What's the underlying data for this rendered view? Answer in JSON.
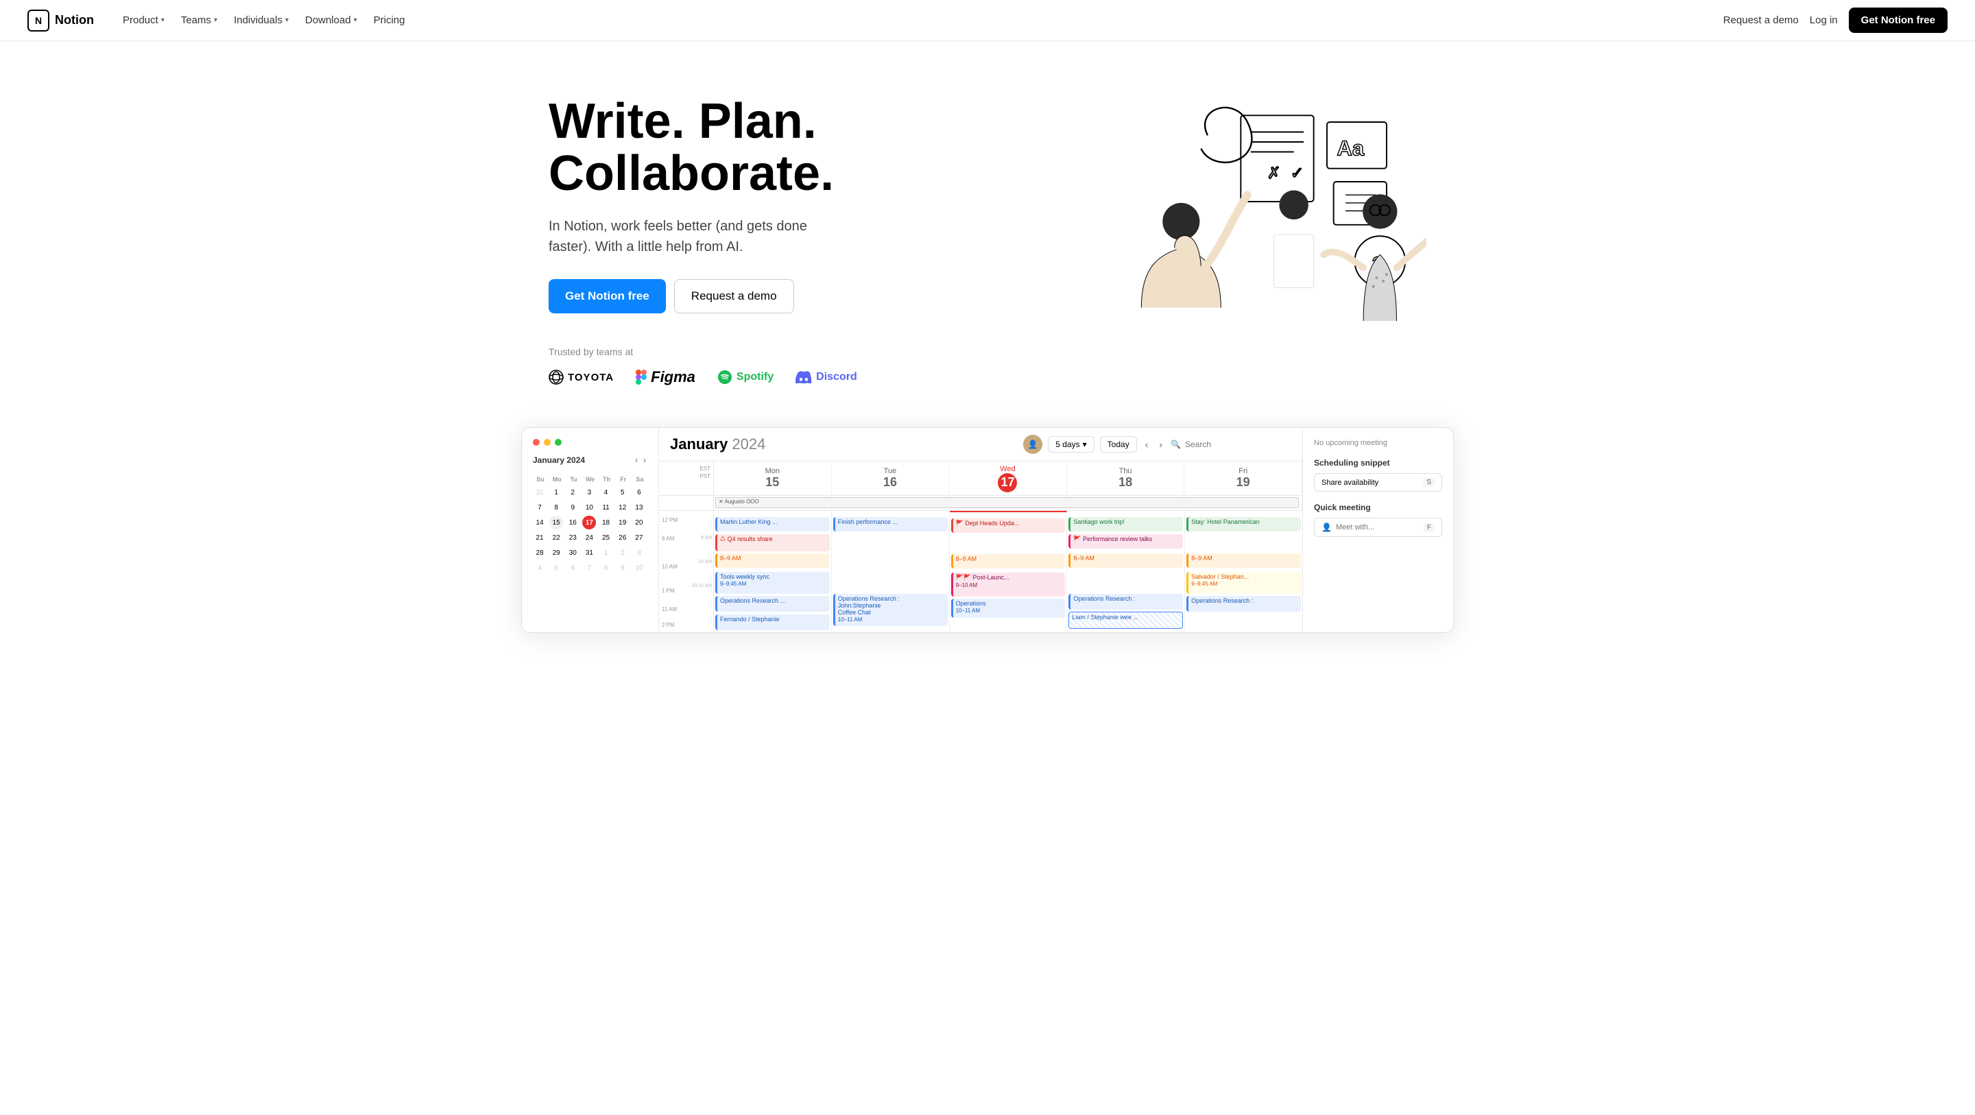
{
  "nav": {
    "logo": "Notion",
    "logo_icon": "N",
    "links": [
      {
        "label": "Product",
        "has_dropdown": true
      },
      {
        "label": "Teams",
        "has_dropdown": true
      },
      {
        "label": "Individuals",
        "has_dropdown": true
      },
      {
        "label": "Download",
        "has_dropdown": true
      },
      {
        "label": "Pricing",
        "has_dropdown": false
      }
    ],
    "request_demo": "Request a demo",
    "login": "Log in",
    "cta": "Get Notion free"
  },
  "hero": {
    "title": "Write. Plan.\nCollaborate.",
    "subtitle": "In Notion, work feels better (and gets done faster). With a little help from AI.",
    "cta_primary": "Get Notion free",
    "cta_secondary": "Request a demo",
    "trusted_label": "Trusted by teams at",
    "brands": [
      "TOYOTA",
      "Figma",
      "Spotify",
      "Discord"
    ]
  },
  "calendar": {
    "window_controls": [
      "●",
      "●",
      "●"
    ],
    "mini_cal": {
      "title": "January 2024",
      "day_labels": [
        "Su",
        "Mo",
        "Tu",
        "We",
        "Th",
        "Fr",
        "Sa"
      ],
      "rows": [
        [
          {
            "n": "31",
            "other": true
          },
          {
            "n": "1"
          },
          {
            "n": "2"
          },
          {
            "n": "3"
          },
          {
            "n": "4"
          },
          {
            "n": "5"
          },
          {
            "n": "6"
          }
        ],
        [
          {
            "n": "7"
          },
          {
            "n": "8"
          },
          {
            "n": "9"
          },
          {
            "n": "10"
          },
          {
            "n": "11"
          },
          {
            "n": "12"
          },
          {
            "n": "13"
          }
        ],
        [
          {
            "n": "14"
          },
          {
            "n": "15",
            "sel": true
          },
          {
            "n": "16"
          },
          {
            "n": "17",
            "today": true
          },
          {
            "n": "18"
          },
          {
            "n": "19"
          },
          {
            "n": "20"
          }
        ],
        [
          {
            "n": "21"
          },
          {
            "n": "22"
          },
          {
            "n": "23"
          },
          {
            "n": "24"
          },
          {
            "n": "25"
          },
          {
            "n": "26"
          },
          {
            "n": "27"
          }
        ],
        [
          {
            "n": "28"
          },
          {
            "n": "29"
          },
          {
            "n": "30"
          },
          {
            "n": "31"
          },
          {
            "n": "1",
            "other": true
          },
          {
            "n": "2",
            "other": true
          },
          {
            "n": "3",
            "other": true
          }
        ],
        [
          {
            "n": "4",
            "other": true
          },
          {
            "n": "5",
            "other": true
          },
          {
            "n": "6",
            "other": true
          },
          {
            "n": "7",
            "other": true
          },
          {
            "n": "8",
            "other": true
          },
          {
            "n": "9",
            "other": true
          },
          {
            "n": "10",
            "other": true
          }
        ]
      ]
    },
    "toolbar": {
      "days_btn": "5 days",
      "today_btn": "Today",
      "search_placeholder": "Search"
    },
    "header_title": "January",
    "header_year": "2024",
    "days": [
      {
        "label": "Mon 15",
        "date": "15",
        "today": false
      },
      {
        "label": "Tue 16",
        "date": "16",
        "today": false
      },
      {
        "label": "Wed 17",
        "date": "17",
        "today": true
      },
      {
        "label": "Thu 18",
        "date": "18",
        "today": false
      },
      {
        "label": "Fri 19",
        "date": "19",
        "today": false
      }
    ],
    "timezones": [
      "EST",
      "PST"
    ],
    "allday_events": [
      {
        "col": 0,
        "text": "Augusto OOO",
        "color": "gray",
        "span": 5
      }
    ],
    "events": {
      "col0": [
        {
          "text": "Martin Luther King ...",
          "top": "10%",
          "height": "12%",
          "color": "blue"
        },
        {
          "text": "Q4 results share",
          "top": "22%",
          "height": "12%",
          "color": "red"
        },
        {
          "text": "8–9 AM",
          "top": "34%",
          "height": "12%",
          "color": "orange"
        },
        {
          "text": "Tools weekly sync\n9–9:45 AM",
          "top": "50%",
          "height": "16%",
          "color": "blue"
        },
        {
          "text": "Operations Research ...",
          "top": "68%",
          "height": "14%",
          "color": "blue"
        },
        {
          "text": "Fernando / Stephanie",
          "top": "84%",
          "height": "14%",
          "color": "blue"
        }
      ],
      "col1": [
        {
          "text": "Finish performance ...",
          "top": "10%",
          "height": "12%",
          "color": "blue"
        },
        {
          "text": "Operations Research :\nJohn:Stephanie\nCoffee Chat\n10–11 AM",
          "top": "68%",
          "height": "22%",
          "color": "blue"
        }
      ],
      "col2": [
        {
          "text": "Dept Heads Upda...",
          "top": "10%",
          "height": "12%",
          "color": "red"
        },
        {
          "text": "8–9 AM",
          "top": "34%",
          "height": "12%",
          "color": "orange"
        },
        {
          "text": "Post-Launc...\n9–10 AM",
          "top": "50%",
          "height": "18%",
          "color": "pink"
        },
        {
          "text": "Operations\n10–11 AM",
          "top": "70%",
          "height": "16%",
          "color": "blue"
        }
      ],
      "col3": [
        {
          "text": "Santiago work trip!",
          "top": "10%",
          "height": "12%",
          "color": "green"
        },
        {
          "text": "Performance review talks",
          "top": "22%",
          "height": "12%",
          "color": "pink"
        },
        {
          "text": "8–9 AM",
          "top": "34%",
          "height": "12%",
          "color": "orange"
        },
        {
          "text": "Operations Research :",
          "top": "68%",
          "height": "12%",
          "color": "blue"
        },
        {
          "text": "Liam / Stephanie wee ...",
          "top": "82%",
          "height": "14%",
          "color": "stripe"
        }
      ],
      "col4": [
        {
          "text": "Stay: Hotel Panamerican",
          "top": "10%",
          "height": "12%",
          "color": "green"
        },
        {
          "text": "8–9 AM",
          "top": "34%",
          "height": "12%",
          "color": "orange"
        },
        {
          "text": "Salvador / Stephan...\n9–9:45 AM",
          "top": "50%",
          "height": "16%",
          "color": "yellow"
        },
        {
          "text": "Operations Research :",
          "top": "68%",
          "height": "12%",
          "color": "blue"
        }
      ]
    },
    "right_panel": {
      "no_meeting_label": "No upcoming meeting",
      "scheduling_title": "Scheduling snippet",
      "share_availability": "Share availability",
      "share_key": "S",
      "quick_meeting_title": "Quick meeting",
      "meet_placeholder": "Meet with...",
      "meet_key": "F"
    }
  }
}
